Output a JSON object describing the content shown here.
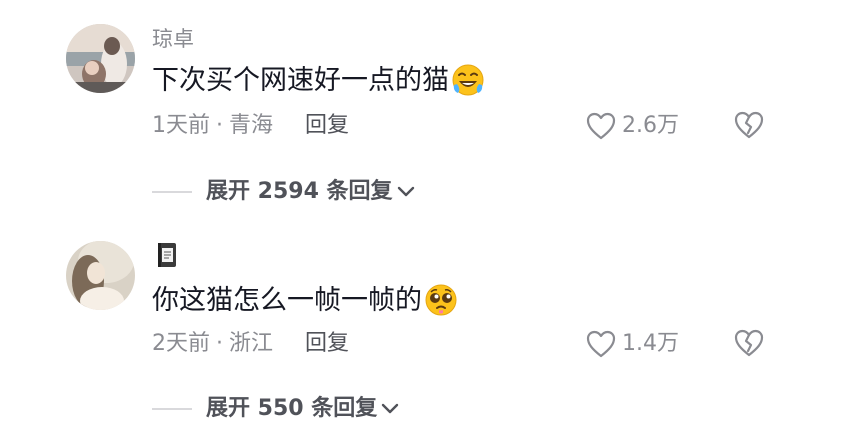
{
  "comments": [
    {
      "username": "琼卓",
      "text": "下次买个网速好一点的猫",
      "emoji": "grinning-sweat-tears-emoji",
      "time": "1天前",
      "dot": "·",
      "location": "青海",
      "reply_label": "回复",
      "likes": "2.6万",
      "expand_label": "展开 2594 条回复"
    },
    {
      "username_icon": "notebook-emoji",
      "text": "你这猫怎么一帧一帧的",
      "emoji": "pleading-face-emoji",
      "time": "2天前",
      "dot": "·",
      "location": "浙江",
      "reply_label": "回复",
      "likes": "1.4万",
      "expand_label": "展开 550 条回复"
    }
  ],
  "colors": {
    "primary_text": "#161823",
    "secondary_text": "#8a8b91",
    "reply_text": "#505259",
    "background": "#ffffff"
  }
}
